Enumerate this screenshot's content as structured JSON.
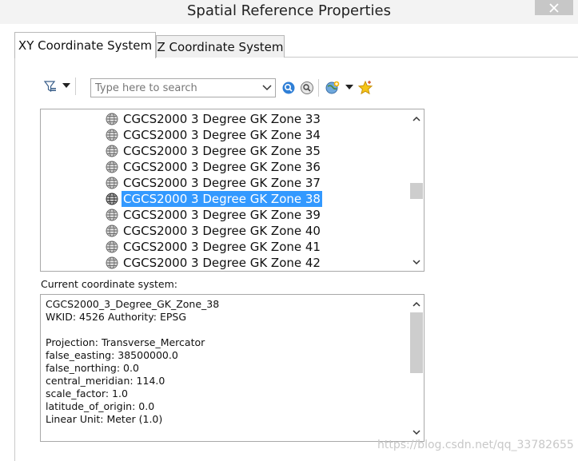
{
  "window": {
    "title": "Spatial Reference Properties"
  },
  "tabs": [
    {
      "label": "XY Coordinate System",
      "active": true
    },
    {
      "label": "Z Coordinate System",
      "active": false
    }
  ],
  "toolbar": {
    "filter_icon": "filter-icon",
    "search": {
      "placeholder": "Type here to search",
      "value": ""
    },
    "search_button_icon": "magnifier-icon",
    "search_options_icon": "search-options-icon",
    "add_coordinate_system_icon": "globe-add-icon",
    "favorites_icon": "star-icon"
  },
  "coordinate_list": {
    "items": [
      "CGCS2000 3 Degree GK Zone 33",
      "CGCS2000 3 Degree GK Zone 34",
      "CGCS2000 3 Degree GK Zone 35",
      "CGCS2000 3 Degree GK Zone 36",
      "CGCS2000 3 Degree GK Zone 37",
      "CGCS2000 3 Degree GK Zone 38",
      "CGCS2000 3 Degree GK Zone 39",
      "CGCS2000 3 Degree GK Zone 40",
      "CGCS2000 3 Degree GK Zone 41",
      "CGCS2000 3 Degree GK Zone 42"
    ],
    "selected": "CGCS2000 3 Degree GK Zone 38"
  },
  "current": {
    "label": "Current coordinate system:",
    "lines": [
      "CGCS2000_3_Degree_GK_Zone_38",
      "WKID: 4526 Authority: EPSG",
      "",
      "Projection: Transverse_Mercator",
      "false_easting: 38500000.0",
      "false_northing: 0.0",
      "central_meridian: 114.0",
      "scale_factor: 1.0",
      "latitude_of_origin: 0.0",
      "Linear Unit: Meter (1.0)"
    ]
  },
  "watermark": "https://blog.csdn.net/qq_33782655",
  "colors": {
    "selection": "#3399ff",
    "scroll_thumb": "#cdcdcd"
  }
}
